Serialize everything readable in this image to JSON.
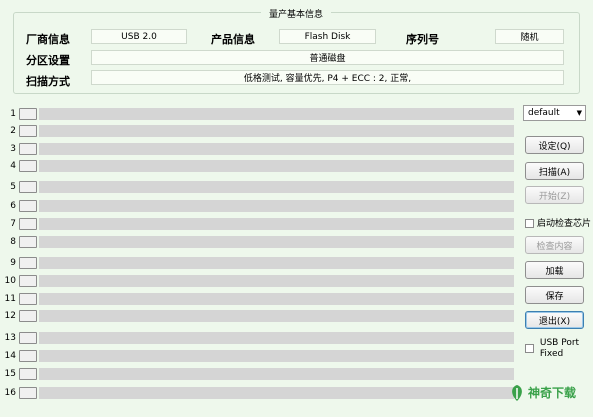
{
  "info": {
    "title": "量产基本信息",
    "vendor_label": "厂商信息",
    "vendor_value": "USB 2.0",
    "product_label": "产品信息",
    "product_value": "Flash Disk",
    "serial_label": "序列号",
    "serial_value": "随机",
    "partition_label": "分区设置",
    "partition_value": "普通磁盘",
    "scan_label": "扫描方式",
    "scan_value": "低格测试, 容量优先, P4 + ECC : 2, 正常,"
  },
  "rows": [
    "1",
    "2",
    "3",
    "4",
    "5",
    "6",
    "7",
    "8",
    "9",
    "10",
    "11",
    "12",
    "13",
    "14",
    "15",
    "16"
  ],
  "controls": {
    "mode_select": "default",
    "settings_button": "设定(Q)",
    "scan_button": "扫描(A)",
    "start_button": "开始(Z)",
    "check_chip_label": "启动检查芯片",
    "check_content_button": "检查内容",
    "load_button": "加载",
    "save_button": "保存",
    "exit_button": "退出(X)",
    "usb_port_fixed_line1": "USB Port",
    "usb_port_fixed_line2": "Fixed"
  },
  "watermark": {
    "text": "神奇下载"
  }
}
